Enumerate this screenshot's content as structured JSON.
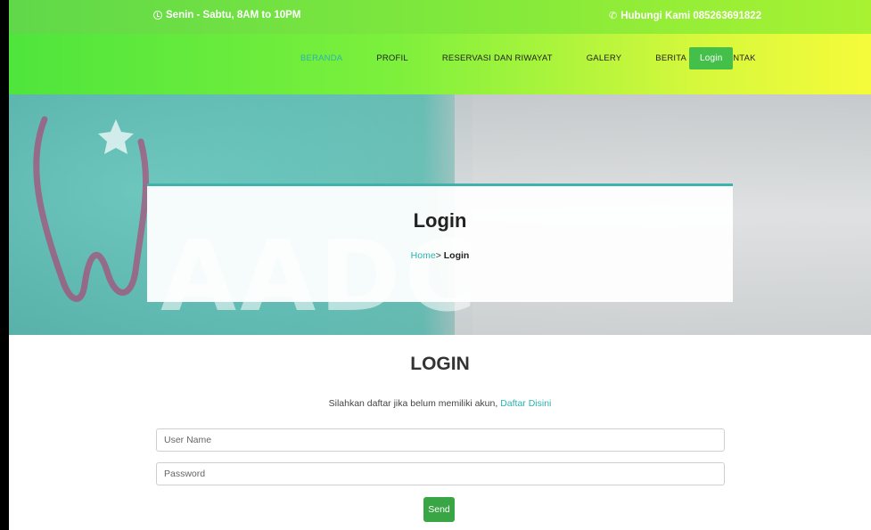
{
  "topbar": {
    "hours_text": "Senin - Sabtu, 8AM to 10PM",
    "contact_text": "Hubungi Kami 085263691822",
    "icons": {
      "hours": "clock-icon",
      "contact": "phone-icon"
    }
  },
  "nav": {
    "items": [
      {
        "label": "BERANDA",
        "active": true
      },
      {
        "label": "PROFIL",
        "active": false
      },
      {
        "label": "RESERVASI DAN RIWAYAT",
        "active": false
      },
      {
        "label": "GALERY",
        "active": false
      },
      {
        "label": "BERITA",
        "active": false
      },
      {
        "label": "KONTAK",
        "active": false
      }
    ],
    "login_label": "Login"
  },
  "hero": {
    "title": "Login",
    "breadcrumb_home": "Home",
    "breadcrumb_separator": ">",
    "breadcrumb_current": "Login",
    "logo_text": "AADC"
  },
  "login_form": {
    "heading": "LOGIN",
    "hint_text": "Silahkan daftar jika belum memiliki akun,",
    "hint_link": "Daftar Disini",
    "username_placeholder": "User Name",
    "password_placeholder": "Password",
    "submit_label": "Send"
  },
  "colors": {
    "accent": "#2bb3ad",
    "button_green": "#3aa545",
    "nav_gradient_start": "#4fe53c",
    "nav_gradient_end": "#f5fb3a"
  }
}
